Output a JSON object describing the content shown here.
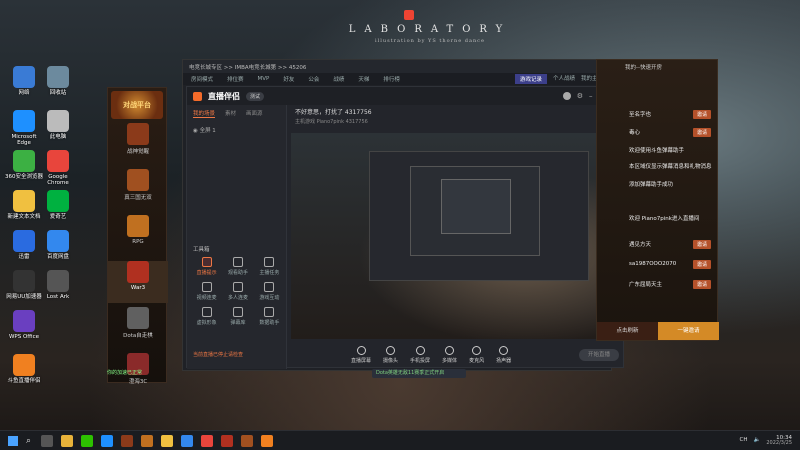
{
  "wall": {
    "title": "LABORATORY",
    "subtitle": "illustration by YS thorne dance"
  },
  "desktop_icons": [
    {
      "label": "网络",
      "color": "#3a7bd5"
    },
    {
      "label": "回收站",
      "color": "#6c8a9e"
    },
    {
      "label": "Microsoft Edge",
      "color": "#1e90ff"
    },
    {
      "label": "此电脑",
      "color": "#bbb"
    },
    {
      "label": "360安全浏览器",
      "color": "#3cb043"
    },
    {
      "label": "Google Chrome",
      "color": "#e8453c"
    },
    {
      "label": "新建文本文档",
      "color": "#f0c040"
    },
    {
      "label": "爱奇艺",
      "color": "#00b140"
    },
    {
      "label": "迅雷",
      "color": "#2a6be0"
    },
    {
      "label": "百度网盘",
      "color": "#3388ee"
    },
    {
      "label": "网易UU加速器",
      "color": "#333"
    },
    {
      "label": "Lost Ark",
      "color": "#555"
    },
    {
      "label": "WPS Office",
      "color": "#6a3fc0"
    },
    {
      "label": "斗鱼直播伴侣",
      "color": "#f08020"
    }
  ],
  "launcher": {
    "logo": "对战平台",
    "items": [
      {
        "label": "战神觉醒",
        "color": "#8b3a1a"
      },
      {
        "label": "真三国无双",
        "color": "#a05020"
      },
      {
        "label": "RPG",
        "color": "#c07020"
      },
      {
        "label": "War3",
        "color": "#b03020"
      },
      {
        "label": "Dota自走棋",
        "color": "#606060"
      },
      {
        "label": "澄海3C",
        "color": "#8a2a2a"
      }
    ]
  },
  "main_window": {
    "breadcrumb": "电竞长城专区 >> IMBA电竞长城第 >> 45206",
    "tabs": [
      "房间模式",
      "排位赛",
      "MVP",
      "好友",
      "公会",
      "战绩",
      "天梯",
      "排行榜"
    ],
    "right_tabs": [
      "游戏记录",
      "个人战绩",
      "我的主页"
    ]
  },
  "zb": {
    "title": "直播伴侣",
    "version": "测试",
    "left_tabs": [
      "我的场景",
      "素材",
      "画面源"
    ],
    "scene": "全屏 1",
    "tools_title": "工具箱",
    "tools": [
      {
        "label": "直播提示",
        "red": true
      },
      {
        "label": "观看助手",
        "red": false
      },
      {
        "label": "主播任务",
        "red": false
      },
      {
        "label": "视频连麦",
        "red": false
      },
      {
        "label": "多人连麦",
        "red": false
      },
      {
        "label": "游戏互动",
        "red": false
      },
      {
        "label": "虚拟形象",
        "red": false
      },
      {
        "label": "弹幕库",
        "red": false
      },
      {
        "label": "数据助手",
        "red": false
      }
    ],
    "stream_title": "不好意思，打扰了 4317756",
    "stream_meta": "主机游戏  Piano7pink  4317756",
    "bottom_tools": [
      "直播屏幕",
      "摄像头",
      "手机投屏",
      "多媒体",
      "麦克风",
      "扬声器"
    ],
    "start_label": "开始直播",
    "bottom_notice": "当前直播已停止请检查"
  },
  "right_panel": {
    "header": "我的--快速开房",
    "items": [
      {
        "text": "至名字也",
        "btn": "邀请"
      },
      {
        "text": "毒心",
        "btn": "邀请"
      },
      {
        "text": "欢迎使用斗鱼弹幕助手",
        "btn": ""
      },
      {
        "text": "本区域仅显示弹幕消息和礼物消息",
        "btn": ""
      },
      {
        "text": "添加弹幕助手成功",
        "btn": ""
      },
      {
        "text": "欢迎 Piano7pink进入直播间",
        "btn": ""
      },
      {
        "text": "遇见方天",
        "btn": "邀请"
      },
      {
        "text": "sa1987OOO2070",
        "btn": "邀请"
      },
      {
        "text": "广东屈局天主",
        "btn": "邀请"
      }
    ],
    "footer_left": "点击刷新",
    "footer_right": "一键邀请"
  },
  "notice": "Dota英雄无敌11赛季正式开启",
  "tray": "你的加速已正常",
  "taskbar": {
    "lang": "CH",
    "time": "10:34",
    "date": "2022/3/25"
  }
}
